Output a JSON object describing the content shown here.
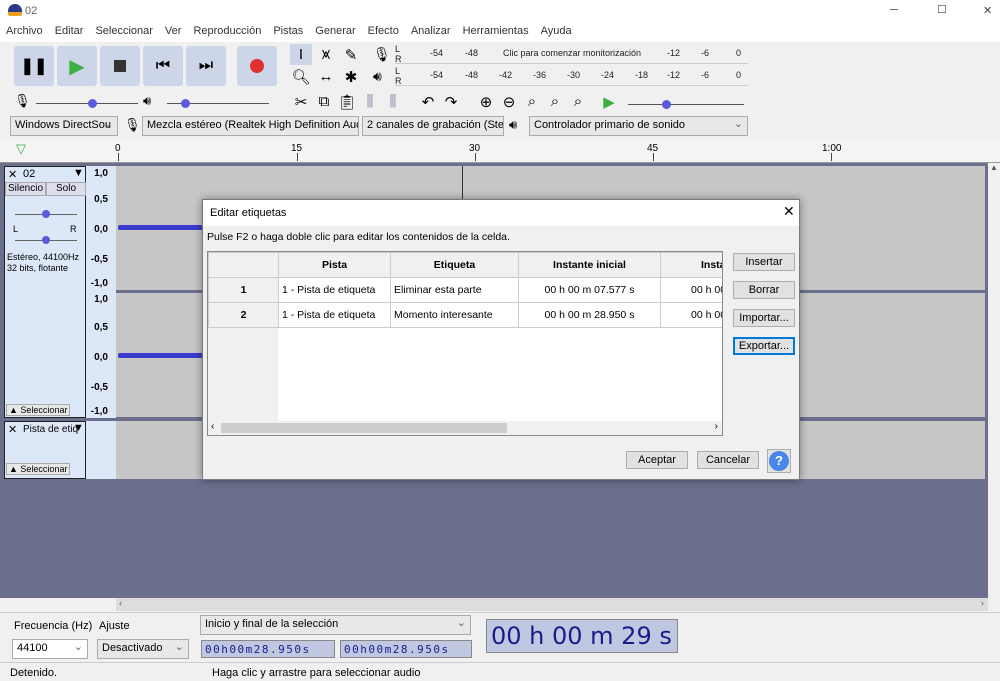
{
  "window": {
    "title": "02",
    "minimize": "─",
    "maximize": "☐",
    "close": "✕"
  },
  "menu": [
    "Archivo",
    "Editar",
    "Seleccionar",
    "Ver",
    "Reproducción",
    "Pistas",
    "Generar",
    "Efecto",
    "Analizar",
    "Herramientas",
    "Ayuda"
  ],
  "meters": {
    "record_ticks": [
      "-54",
      "-48",
      "-12",
      "-6",
      "0"
    ],
    "record_hint": "Clic para comenzar monitorización",
    "play_ticks": [
      "-54",
      "-48",
      "-42",
      "-36",
      "-30",
      "-24",
      "-18",
      "-12",
      "-6",
      "0"
    ],
    "lr": [
      "L",
      "R"
    ]
  },
  "devices": {
    "host": "Windows DirectSou",
    "input": "Mezcla estéreo (Realtek High Definition Aud",
    "channels": "2 canales de grabación (Ster",
    "output": "Controlador primario de sonido"
  },
  "ruler": {
    "ticks": [
      "0",
      "15",
      "30",
      "45",
      "1:00"
    ]
  },
  "tracks": {
    "audio": {
      "name": "02",
      "mute": "Silencio",
      "solo": "Solo",
      "gain_minus": "-",
      "gain_plus": "+",
      "pan_l": "L",
      "pan_r": "R",
      "info": "Estéreo, 44100Hz\n32 bits, flotante",
      "select": "Seleccionar",
      "scale": [
        "1,0",
        "0,5",
        "0,0",
        "-0,5",
        "-1,0"
      ]
    },
    "label": {
      "name": "Pista de etiq",
      "select": "Seleccionar"
    }
  },
  "dialog": {
    "title": "Editar etiquetas",
    "hint": "Pulse F2 o haga doble clic para editar los contenidos de la celda.",
    "columns": [
      "",
      "Pista",
      "Etiqueta",
      "Instante inicial",
      "Insta"
    ],
    "rows": [
      {
        "n": "1",
        "track": "1 - Pista de etiqueta",
        "label": "Eliminar esta parte",
        "start": "00 h 00 m 07.577 s",
        "end": "00 h 00"
      },
      {
        "n": "2",
        "track": "1 - Pista de etiqueta",
        "label": "Momento interesante",
        "start": "00 h 00 m 28.950 s",
        "end": "00 h 00"
      }
    ],
    "buttons": {
      "insert": "Insertar",
      "delete": "Borrar",
      "import": "Importar...",
      "export": "Exportar...",
      "ok": "Aceptar",
      "cancel": "Cancelar",
      "help": "?"
    }
  },
  "bottom": {
    "rate_label": "Frecuencia (Hz)",
    "rate": "44100",
    "snap_label": "Ajuste",
    "snap": "Desactivado",
    "selection_mode": "Inicio y final de la selección",
    "sel_start": "00h00m28.950s",
    "sel_end": "00h00m28.950s",
    "position": "00 h 00 m 29 s"
  },
  "status": {
    "state": "Detenido.",
    "hint": "Haga clic y arrastre para seleccionar audio"
  },
  "colors": {
    "waveform": "#3a3acc",
    "track_bg": "#6b6f8c",
    "record": "#e03030",
    "play": "#3cb043"
  }
}
